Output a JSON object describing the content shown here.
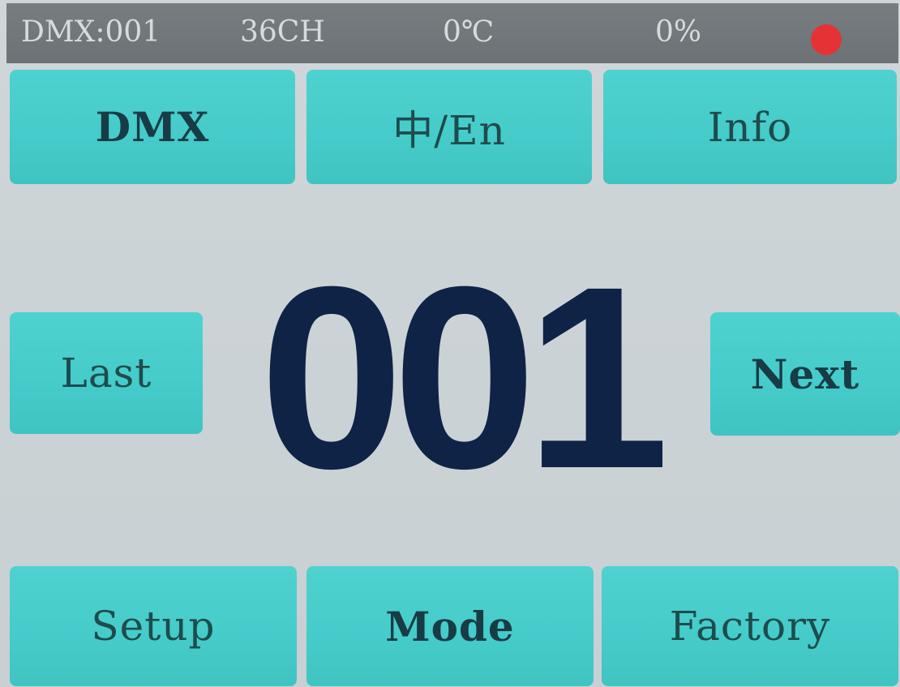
{
  "status_bar": {
    "dmx": "DMX:001",
    "channels": "36CH",
    "temperature": "0℃",
    "percent": "0%",
    "indicator_color": "#e53335"
  },
  "top_buttons": {
    "dmx": "DMX",
    "language": "中/En",
    "info": "Info"
  },
  "center": {
    "address_value": "001",
    "last_label": "Last",
    "next_label": "Next"
  },
  "bottom_buttons": {
    "setup": "Setup",
    "mode": "Mode",
    "factory": "Factory"
  },
  "colors": {
    "button_bg": "#45cbc9",
    "status_bg": "#6c7275",
    "number_color": "#0f2347"
  }
}
